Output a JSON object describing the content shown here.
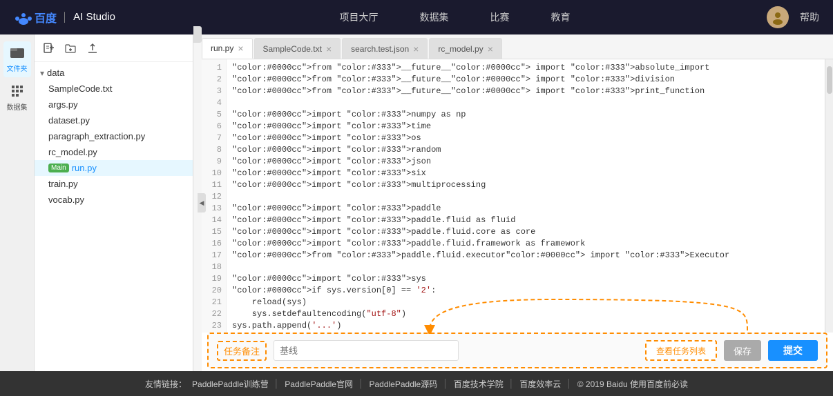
{
  "nav": {
    "logo_baidu": "Baidu",
    "logo_separator": "│",
    "logo_ai": "AI Studio",
    "items": [
      "项目大厅",
      "数据集",
      "比赛",
      "教育"
    ],
    "help": "帮助"
  },
  "sidebar_icons": [
    {
      "id": "files",
      "label": "文件夹",
      "symbol": "📁",
      "active": true
    },
    {
      "id": "data",
      "label": "数据集",
      "symbol": "⠿"
    }
  ],
  "file_panel": {
    "toolbar_buttons": [
      "new-file",
      "new-folder",
      "upload"
    ],
    "folder_name": "data",
    "files": [
      {
        "name": "SampleCode.txt",
        "active": false,
        "main": false
      },
      {
        "name": "args.py",
        "active": false,
        "main": false
      },
      {
        "name": "dataset.py",
        "active": false,
        "main": false
      },
      {
        "name": "paragraph_extraction.py",
        "active": false,
        "main": false
      },
      {
        "name": "rc_model.py",
        "active": false,
        "main": false
      },
      {
        "name": "run.py",
        "active": true,
        "main": true
      },
      {
        "name": "train.py",
        "active": false,
        "main": false
      },
      {
        "name": "vocab.py",
        "active": false,
        "main": false
      }
    ]
  },
  "editor": {
    "tabs": [
      {
        "name": "run.py",
        "active": true
      },
      {
        "name": "SampleCode.txt",
        "active": false
      },
      {
        "name": "search.test.json",
        "active": false
      },
      {
        "name": "rc_model.py",
        "active": false
      }
    ],
    "code_lines": [
      "from __future__ import absolute_import",
      "from __future__ import division",
      "from __future__ import print_function",
      "",
      "import numpy as np",
      "import time",
      "import os",
      "import random",
      "import json",
      "import six",
      "import multiprocessing",
      "",
      "import paddle",
      "import paddle.fluid as fluid",
      "import paddle.fluid.core as core",
      "import paddle.fluid.framework as framework",
      "from paddle.fluid.executor import Executor",
      "",
      "import sys",
      "if sys.version[0] == '2':",
      "    reload(sys)",
      "    sys.setdefaultencoding(\"utf-8\")",
      "sys.path.append('...')",
      "..."
    ]
  },
  "submit_bar": {
    "task_note_label": "任务备注",
    "baseline_placeholder": "基线",
    "view_tasks": "查看任务列表",
    "save": "保存",
    "submit": "提交"
  },
  "footer": {
    "prefix": "友情链接：",
    "links": [
      "PaddlePaddle训练营",
      "PaddlePaddle官网",
      "PaddlePaddle源码",
      "百度技术学院",
      "百度效率云"
    ],
    "copyright": "© 2019 Baidu 使用百度前必读"
  }
}
